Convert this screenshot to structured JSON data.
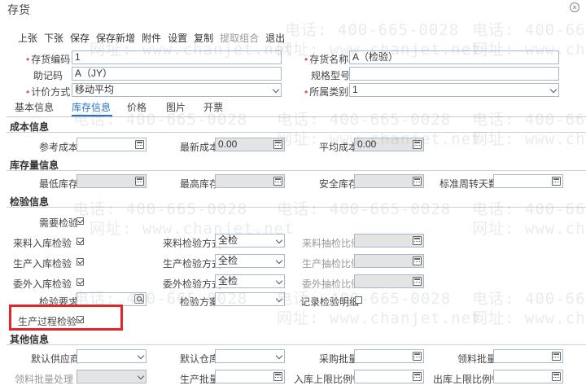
{
  "window": {
    "title": "存货"
  },
  "toolbar": {
    "items": [
      "上张",
      "下张",
      "保存",
      "保存新增",
      "附件",
      "设置",
      "复制",
      "提取组合",
      "退出"
    ]
  },
  "header": {
    "code_label": "存货编码",
    "code_value": "1",
    "name_label": "存货名称",
    "name_value": "A（检验）",
    "mnemonic_label": "助记码",
    "mnemonic_value": "A（JY）",
    "spec_label": "规格型号",
    "spec_value": "",
    "pricing_label": "计价方式",
    "pricing_value": "移动平均",
    "category_label": "所属类别",
    "category_value": "1"
  },
  "tabs": [
    "基本信息",
    "库存信息",
    "价格",
    "图片",
    "开票"
  ],
  "cost": {
    "title": "成本信息",
    "ref_label": "参考成本",
    "ref_value": "",
    "latest_label": "最新成本",
    "latest_value": "0.00",
    "avg_label": "平均成本",
    "avg_value": "0.00"
  },
  "stock": {
    "title": "库存量信息",
    "min_label": "最低库存",
    "max_label": "最高库存",
    "safe_label": "安全库存",
    "turnover_label": "标准周转天数"
  },
  "inspection": {
    "title": "检验信息",
    "need_label": "需要检验",
    "incoming_label": "来料入库检验",
    "incoming_method_label": "来料检验方式",
    "incoming_method_value": "全检",
    "incoming_ratio_label": "来料抽检比例",
    "production_label": "生产入库检验",
    "production_method_label": "生产检验方式",
    "production_method_value": "全检",
    "production_ratio_label": "生产抽检比例",
    "outsource_label": "委外入库检验",
    "outsource_method_label": "委外检验方式",
    "outsource_method_value": "全检",
    "outsource_ratio_label": "委外抽检比例",
    "requirement_label": "检验要求",
    "plan_label": "检验方案",
    "record_label": "记录检验明细",
    "process_label": "生产过程检验"
  },
  "other": {
    "title": "其他信息",
    "supplier_label": "默认供应商",
    "warehouse_label": "默认仓库",
    "purchase_batch_label": "采购批量",
    "picking_batch_label": "领料批量",
    "picking_process_label": "领料批量处理",
    "production_batch_label": "生产批量",
    "inbound_limit_label": "入库上限比例%",
    "outbound_limit_label": "出库上限比例%"
  },
  "watermark": {
    "phone": "电话: 400-665-0028",
    "url": "网址: www.chanjet.net"
  },
  "colors": {
    "accent": "#2a72c9",
    "highlight": "#e0262b",
    "required": "#e05050"
  }
}
